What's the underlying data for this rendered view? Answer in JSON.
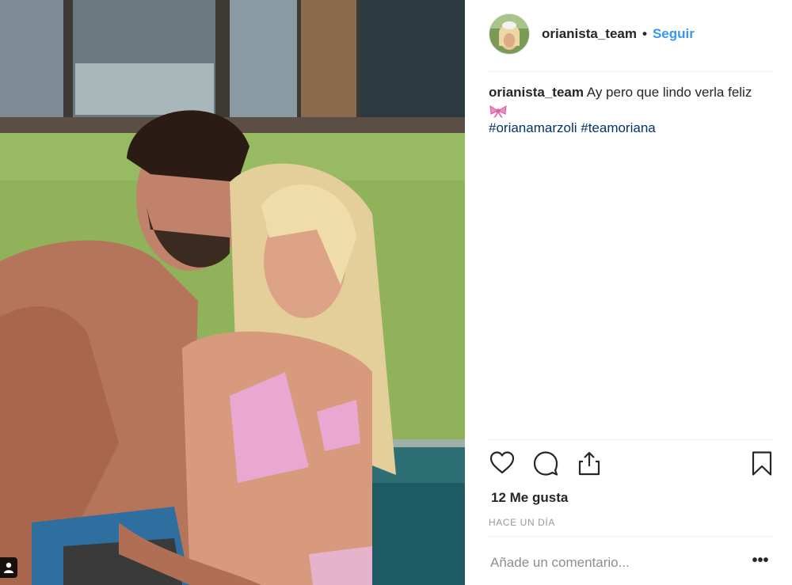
{
  "post": {
    "photo_alt": "Post photo",
    "photo_icon": "person-tag-icon"
  },
  "header": {
    "username": "orianista_team",
    "separator": "•",
    "follow_label": "Seguir"
  },
  "caption": {
    "username": "orianista_team",
    "text": "Ay pero que lindo verla feliz",
    "emoji_icon": "pink-bow-icon",
    "hashtags": [
      "#orianamarzoli",
      "#teamoriana"
    ]
  },
  "actions": {
    "like_icon": "heart-icon",
    "comment_icon": "comment-icon",
    "share_icon": "share-icon",
    "save_icon": "bookmark-icon"
  },
  "likes_text": "12 Me gusta",
  "timestamp": "HACE UN DÍA",
  "comment_box": {
    "placeholder": "Añade un comentario...",
    "more_label": "•••"
  },
  "colors": {
    "follow": "#3897f0",
    "hashtag": "#003569",
    "text": "#262626",
    "muted": "#999999"
  }
}
